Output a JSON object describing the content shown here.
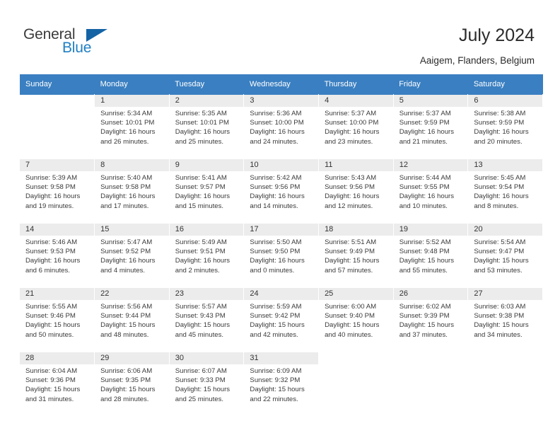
{
  "brand": {
    "name_part1": "General",
    "name_part2": "Blue",
    "accent_color": "#1f7fc4",
    "triangle_color": "#1464a5"
  },
  "header": {
    "title": "July 2024",
    "location": "Aaigem, Flanders, Belgium"
  },
  "calendar": {
    "header_bg": "#3a7fc1",
    "daynum_bg": "#ececec",
    "weekdays": [
      "Sunday",
      "Monday",
      "Tuesday",
      "Wednesday",
      "Thursday",
      "Friday",
      "Saturday"
    ],
    "weeks": [
      [
        null,
        {
          "day": "1",
          "sunrise": "Sunrise: 5:34 AM",
          "sunset": "Sunset: 10:01 PM",
          "daylight1": "Daylight: 16 hours",
          "daylight2": "and 26 minutes."
        },
        {
          "day": "2",
          "sunrise": "Sunrise: 5:35 AM",
          "sunset": "Sunset: 10:01 PM",
          "daylight1": "Daylight: 16 hours",
          "daylight2": "and 25 minutes."
        },
        {
          "day": "3",
          "sunrise": "Sunrise: 5:36 AM",
          "sunset": "Sunset: 10:00 PM",
          "daylight1": "Daylight: 16 hours",
          "daylight2": "and 24 minutes."
        },
        {
          "day": "4",
          "sunrise": "Sunrise: 5:37 AM",
          "sunset": "Sunset: 10:00 PM",
          "daylight1": "Daylight: 16 hours",
          "daylight2": "and 23 minutes."
        },
        {
          "day": "5",
          "sunrise": "Sunrise: 5:37 AM",
          "sunset": "Sunset: 9:59 PM",
          "daylight1": "Daylight: 16 hours",
          "daylight2": "and 21 minutes."
        },
        {
          "day": "6",
          "sunrise": "Sunrise: 5:38 AM",
          "sunset": "Sunset: 9:59 PM",
          "daylight1": "Daylight: 16 hours",
          "daylight2": "and 20 minutes."
        }
      ],
      [
        {
          "day": "7",
          "sunrise": "Sunrise: 5:39 AM",
          "sunset": "Sunset: 9:58 PM",
          "daylight1": "Daylight: 16 hours",
          "daylight2": "and 19 minutes."
        },
        {
          "day": "8",
          "sunrise": "Sunrise: 5:40 AM",
          "sunset": "Sunset: 9:58 PM",
          "daylight1": "Daylight: 16 hours",
          "daylight2": "and 17 minutes."
        },
        {
          "day": "9",
          "sunrise": "Sunrise: 5:41 AM",
          "sunset": "Sunset: 9:57 PM",
          "daylight1": "Daylight: 16 hours",
          "daylight2": "and 15 minutes."
        },
        {
          "day": "10",
          "sunrise": "Sunrise: 5:42 AM",
          "sunset": "Sunset: 9:56 PM",
          "daylight1": "Daylight: 16 hours",
          "daylight2": "and 14 minutes."
        },
        {
          "day": "11",
          "sunrise": "Sunrise: 5:43 AM",
          "sunset": "Sunset: 9:56 PM",
          "daylight1": "Daylight: 16 hours",
          "daylight2": "and 12 minutes."
        },
        {
          "day": "12",
          "sunrise": "Sunrise: 5:44 AM",
          "sunset": "Sunset: 9:55 PM",
          "daylight1": "Daylight: 16 hours",
          "daylight2": "and 10 minutes."
        },
        {
          "day": "13",
          "sunrise": "Sunrise: 5:45 AM",
          "sunset": "Sunset: 9:54 PM",
          "daylight1": "Daylight: 16 hours",
          "daylight2": "and 8 minutes."
        }
      ],
      [
        {
          "day": "14",
          "sunrise": "Sunrise: 5:46 AM",
          "sunset": "Sunset: 9:53 PM",
          "daylight1": "Daylight: 16 hours",
          "daylight2": "and 6 minutes."
        },
        {
          "day": "15",
          "sunrise": "Sunrise: 5:47 AM",
          "sunset": "Sunset: 9:52 PM",
          "daylight1": "Daylight: 16 hours",
          "daylight2": "and 4 minutes."
        },
        {
          "day": "16",
          "sunrise": "Sunrise: 5:49 AM",
          "sunset": "Sunset: 9:51 PM",
          "daylight1": "Daylight: 16 hours",
          "daylight2": "and 2 minutes."
        },
        {
          "day": "17",
          "sunrise": "Sunrise: 5:50 AM",
          "sunset": "Sunset: 9:50 PM",
          "daylight1": "Daylight: 16 hours",
          "daylight2": "and 0 minutes."
        },
        {
          "day": "18",
          "sunrise": "Sunrise: 5:51 AM",
          "sunset": "Sunset: 9:49 PM",
          "daylight1": "Daylight: 15 hours",
          "daylight2": "and 57 minutes."
        },
        {
          "day": "19",
          "sunrise": "Sunrise: 5:52 AM",
          "sunset": "Sunset: 9:48 PM",
          "daylight1": "Daylight: 15 hours",
          "daylight2": "and 55 minutes."
        },
        {
          "day": "20",
          "sunrise": "Sunrise: 5:54 AM",
          "sunset": "Sunset: 9:47 PM",
          "daylight1": "Daylight: 15 hours",
          "daylight2": "and 53 minutes."
        }
      ],
      [
        {
          "day": "21",
          "sunrise": "Sunrise: 5:55 AM",
          "sunset": "Sunset: 9:46 PM",
          "daylight1": "Daylight: 15 hours",
          "daylight2": "and 50 minutes."
        },
        {
          "day": "22",
          "sunrise": "Sunrise: 5:56 AM",
          "sunset": "Sunset: 9:44 PM",
          "daylight1": "Daylight: 15 hours",
          "daylight2": "and 48 minutes."
        },
        {
          "day": "23",
          "sunrise": "Sunrise: 5:57 AM",
          "sunset": "Sunset: 9:43 PM",
          "daylight1": "Daylight: 15 hours",
          "daylight2": "and 45 minutes."
        },
        {
          "day": "24",
          "sunrise": "Sunrise: 5:59 AM",
          "sunset": "Sunset: 9:42 PM",
          "daylight1": "Daylight: 15 hours",
          "daylight2": "and 42 minutes."
        },
        {
          "day": "25",
          "sunrise": "Sunrise: 6:00 AM",
          "sunset": "Sunset: 9:40 PM",
          "daylight1": "Daylight: 15 hours",
          "daylight2": "and 40 minutes."
        },
        {
          "day": "26",
          "sunrise": "Sunrise: 6:02 AM",
          "sunset": "Sunset: 9:39 PM",
          "daylight1": "Daylight: 15 hours",
          "daylight2": "and 37 minutes."
        },
        {
          "day": "27",
          "sunrise": "Sunrise: 6:03 AM",
          "sunset": "Sunset: 9:38 PM",
          "daylight1": "Daylight: 15 hours",
          "daylight2": "and 34 minutes."
        }
      ],
      [
        {
          "day": "28",
          "sunrise": "Sunrise: 6:04 AM",
          "sunset": "Sunset: 9:36 PM",
          "daylight1": "Daylight: 15 hours",
          "daylight2": "and 31 minutes."
        },
        {
          "day": "29",
          "sunrise": "Sunrise: 6:06 AM",
          "sunset": "Sunset: 9:35 PM",
          "daylight1": "Daylight: 15 hours",
          "daylight2": "and 28 minutes."
        },
        {
          "day": "30",
          "sunrise": "Sunrise: 6:07 AM",
          "sunset": "Sunset: 9:33 PM",
          "daylight1": "Daylight: 15 hours",
          "daylight2": "and 25 minutes."
        },
        {
          "day": "31",
          "sunrise": "Sunrise: 6:09 AM",
          "sunset": "Sunset: 9:32 PM",
          "daylight1": "Daylight: 15 hours",
          "daylight2": "and 22 minutes."
        },
        null,
        null,
        null
      ]
    ]
  }
}
